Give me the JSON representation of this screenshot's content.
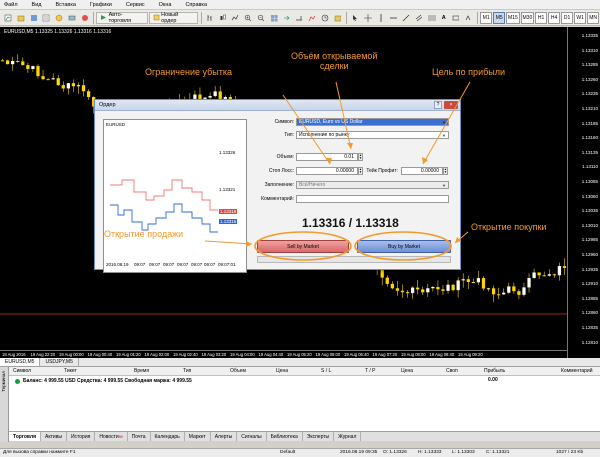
{
  "menu": [
    "Файл",
    "Вид",
    "Вставка",
    "Графики",
    "Сервис",
    "Окна",
    "Справка"
  ],
  "toolbar": {
    "autotrade_label": "Авто-торговля",
    "new_order_label": "Новый ордер",
    "timeframes": [
      "M1",
      "M5",
      "M15",
      "M30",
      "H1",
      "H4",
      "D1",
      "W1",
      "MN"
    ],
    "active_timeframe": "M5"
  },
  "chart": {
    "title": "EURUSD,M5  1.13325 1.13326 1.13316 1.13316",
    "price_ticks": [
      "1.13335",
      "1.13310",
      "1.13285",
      "1.13260",
      "1.13235",
      "1.13210",
      "1.13185",
      "1.13160",
      "1.13135",
      "1.13110",
      "1.13085",
      "1.13060",
      "1.13035",
      "1.13010",
      "1.12985",
      "1.12960",
      "1.12935",
      "1.12910",
      "1.12885",
      "1.12860",
      "1.12835",
      "1.12810"
    ],
    "time_ticks": [
      "18 Aug 2016",
      "19 Aug 22:20",
      "19 Aug 00:00",
      "19 Aug 00:40",
      "19 Aug 01:20",
      "19 Aug 02:00",
      "19 Aug 02:40",
      "19 Aug 03:20",
      "19 Aug 04:00",
      "19 Aug 04:40",
      "19 Aug 05:20",
      "19 Aug 06:00",
      "19 Aug 06:40",
      "19 Aug 07:20",
      "19 Aug 08:00",
      "19 Aug 08:40",
      "19 Aug 09:20"
    ],
    "colors": {
      "bull": "#ffffff",
      "bear": "#ffd700",
      "wick": "#ffd700",
      "bid_line": "#c0392b"
    }
  },
  "chart_tabs": [
    "EURUSD,M5",
    "USDJPY,M5"
  ],
  "dialog": {
    "title": "Ордер",
    "close_label": "×",
    "help_label": "?",
    "mini_chart_symbol": "EURUSD",
    "mini_chart_prices": [
      "1.13326",
      "1.13321",
      "1.13318",
      "1.13316"
    ],
    "mini_chart_times": [
      "2016.08.19",
      "09:07",
      "09:07",
      "09:07",
      "09:07",
      "09:07",
      "09:07",
      "09:07:01"
    ],
    "symbol_label": "Символ:",
    "symbol_value": "EURUSD, Euro vs US Dollar",
    "type_label": "Тип:",
    "type_value": "Исполнение по рынку",
    "volume_label": "Объем:",
    "volume_value": "0.01",
    "sl_label": "Стоп Лосс:",
    "sl_value": "0.00000",
    "tp_label": "Тейк Профит:",
    "tp_value": "0.00000",
    "deviation_label": "Заполнение:",
    "deviation_value": "Всё/Ничего",
    "comment_label": "Комментарий:",
    "comment_value": "",
    "bid": "1.13316",
    "ask": "1.13318",
    "sell_label": "Sell by Market",
    "buy_label": "Buy by Market"
  },
  "annotations": {
    "stop_loss": "Ограничение убытка",
    "volume": "Объём открываемой сделки",
    "volume_l1": "Объём открываемой",
    "volume_l2": "сделки",
    "take_profit": "Цель по прибыли",
    "sell": "Открытие продажи",
    "buy": "Открытие покупки",
    "color": "#f39a2d"
  },
  "terminal": {
    "side_label": "Терминал",
    "columns": [
      "Символ",
      "Тикет",
      "Время",
      "Тип",
      "Объем",
      "Цена",
      "S / L",
      "T / P",
      "Цена",
      "Своп",
      "Прибыль",
      "Комментарий"
    ],
    "balance_text": "Баланс: 4 999.55 USD  Средства: 4 999.55  Свободная маржа: 4 999.55",
    "profit": "0.00",
    "tabs": [
      "Торговля",
      "Активы",
      "История",
      "Новости",
      "Почта",
      "Календарь",
      "Маркет",
      "Алерты",
      "Сигналы",
      "Библиотека",
      "Эксперты",
      "Журнал"
    ],
    "news_badge": "99"
  },
  "status": {
    "hint": "Для вызова справки нажмите F1",
    "profile": "Default",
    "datetime": "2016.08.19 09:35",
    "open": "O: 1.13326",
    "high": "H: 1.13333",
    "low": "L: 1.13303",
    "close": "C: 1.13321",
    "traffic": "1027 / 23 Kb"
  }
}
